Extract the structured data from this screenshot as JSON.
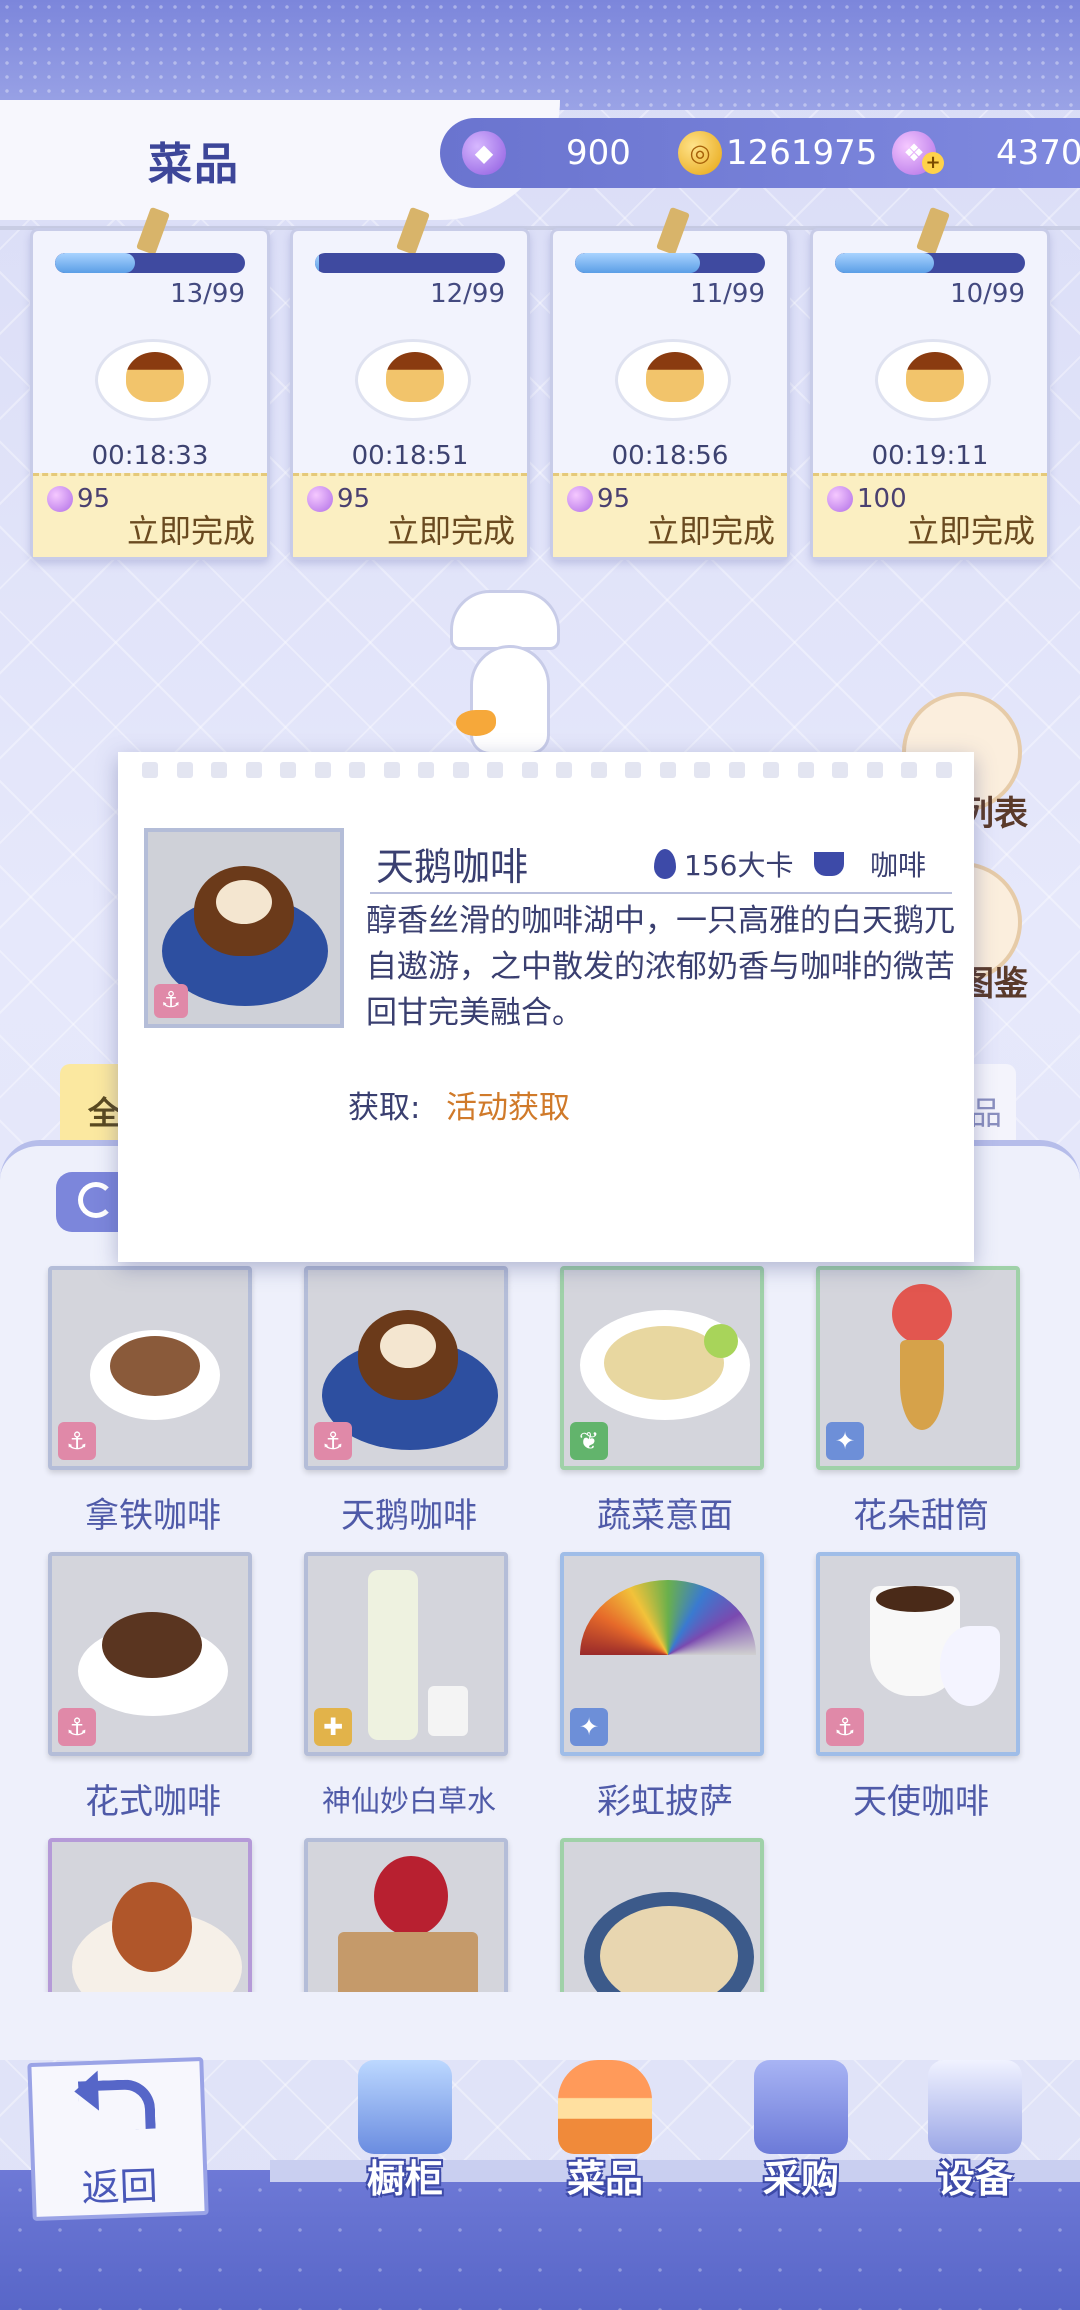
{
  "header": {
    "title": "菜品",
    "currencies": [
      {
        "icon": "purple-gem-icon",
        "value": "900"
      },
      {
        "icon": "gold-coin-icon",
        "value": "1261975"
      },
      {
        "icon": "swan-crystal-icon",
        "value": "4370"
      }
    ]
  },
  "cooking_slots": [
    {
      "count": "13/99",
      "progress": 0.42,
      "timer": "00:18:33",
      "cost": "95",
      "button": "立即完成"
    },
    {
      "count": "12/99",
      "progress": 0.02,
      "timer": "00:18:51",
      "cost": "95",
      "button": "立即完成"
    },
    {
      "count": "11/99",
      "progress": 0.66,
      "timer": "00:18:56",
      "cost": "95",
      "button": "立即完成"
    },
    {
      "count": "10/99",
      "progress": 0.52,
      "timer": "00:19:11",
      "cost": "100",
      "button": "立即完成"
    }
  ],
  "side_buttons": [
    {
      "label": "列表",
      "icon": "box-icon"
    },
    {
      "label": "图鉴",
      "icon": "book-icon"
    }
  ],
  "filter_tabs": {
    "left": "全",
    "right": "品"
  },
  "popup": {
    "name": "天鹅咖啡",
    "kcal": "156大卡",
    "category": "咖啡",
    "description": "醇香丝滑的咖啡湖中，一只高雅的白天鹅兀自遨游，之中散发的浓郁奶香与咖啡的微苦回甘完美融合。",
    "source_label": "获取:",
    "source_value": "活动获取"
  },
  "dishes": [
    {
      "name": "拿铁咖啡",
      "badge": "anchor-icon",
      "badge_color": "pink",
      "frame": "default"
    },
    {
      "name": "天鹅咖啡",
      "badge": "anchor-icon",
      "badge_color": "pink",
      "frame": "default"
    },
    {
      "name": "蔬菜意面",
      "badge": "leaf-icon",
      "badge_color": "green",
      "frame": "green"
    },
    {
      "name": "花朵甜筒",
      "badge": "bulb-icon",
      "badge_color": "blue",
      "frame": "green"
    },
    {
      "name": "花式咖啡",
      "badge": "anchor-icon",
      "badge_color": "pink",
      "frame": "default"
    },
    {
      "name": "神仙妙白草水",
      "badge": "puzzle-icon",
      "badge_color": "gold",
      "frame": "default"
    },
    {
      "name": "彩虹披萨",
      "badge": "bulb-icon",
      "badge_color": "blue",
      "frame": "blue"
    },
    {
      "name": "天使咖啡",
      "badge": "anchor-icon",
      "badge_color": "pink",
      "frame": "blue"
    },
    {
      "name": "",
      "badge": "",
      "badge_color": "",
      "frame": "purple"
    },
    {
      "name": "",
      "badge": "",
      "badge_color": "",
      "frame": "default"
    },
    {
      "name": "",
      "badge": "",
      "badge_color": "",
      "frame": "green"
    }
  ],
  "nav": {
    "back": "返回",
    "items": [
      {
        "label": "橱柜",
        "icon": "drink-cabinet-icon"
      },
      {
        "label": "菜品",
        "icon": "burger-icon"
      },
      {
        "label": "采购",
        "icon": "shopping-bag-icon"
      },
      {
        "label": "设备",
        "icon": "coffee-machine-icon"
      }
    ]
  },
  "colors": {
    "accent": "#7c86db",
    "text": "#3d4699",
    "source": "#d07a2a",
    "gold_panel": "#fbefc2"
  }
}
